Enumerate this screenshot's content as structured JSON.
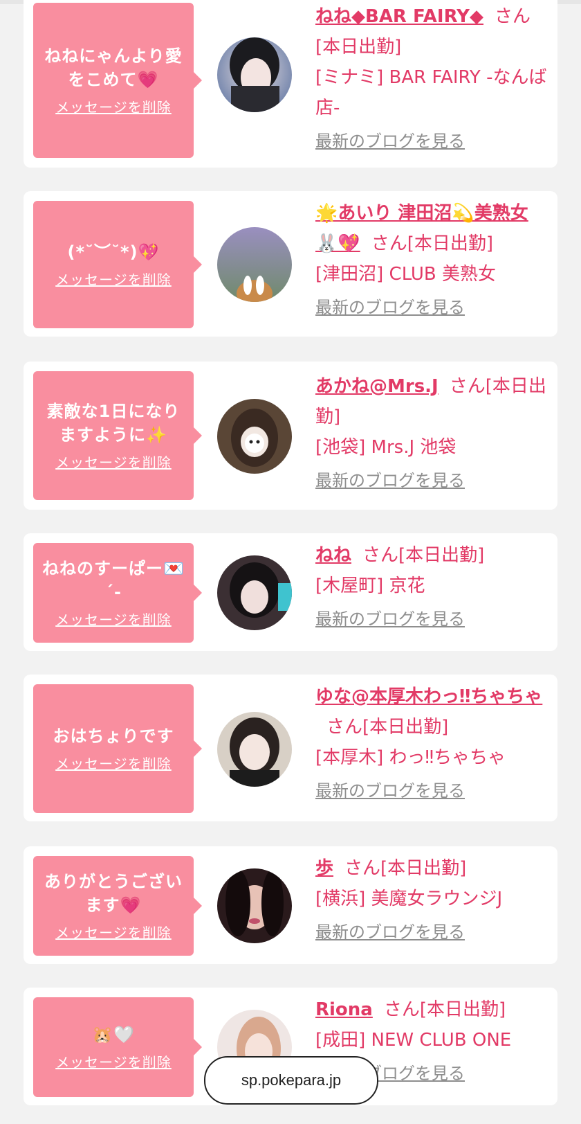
{
  "url_bar": {
    "text": "sp.pokepara.jp"
  },
  "cards": [
    {
      "message": "ねねにゃんより愛をこめて💗",
      "delete_label": "メッセージを削除",
      "name": "ねね◆BAR FAIRY◆",
      "san": "さん",
      "status": "[本日出勤]",
      "shop": "[ミナミ] BAR FAIRY -なんば店-",
      "blog": "最新のブログを見る"
    },
    {
      "message": "(*˘︶˘*)💖",
      "delete_label": "メッセージを削除",
      "name": "🌟あいり 津田沼💫美熟女🐰💖",
      "san": "さん",
      "status": "[本日出勤]",
      "shop": "[津田沼] CLUB 美熟女",
      "blog": "最新のブログを見る"
    },
    {
      "message": "素敵な1日になりますように✨",
      "delete_label": "メッセージを削除",
      "name": "あかね@Mrs.J",
      "san": "さん",
      "status": "[本日出勤]",
      "shop": "[池袋] Mrs.J 池袋",
      "blog": "最新のブログを見る"
    },
    {
      "message": "ねねのすーぱー💌´-",
      "delete_label": "メッセージを削除",
      "name": "ねね",
      "san": "さん",
      "status": "[本日出勤]",
      "shop": "[木屋町] 京花",
      "blog": "最新のブログを見る"
    },
    {
      "message": "おはちょりです",
      "delete_label": "メッセージを削除",
      "name": "ゆな@本厚木わっ‼ちゃちゃ",
      "san": "さん",
      "status": "[本日出勤]",
      "shop": "[本厚木] わっ‼ちゃちゃ",
      "blog": "最新のブログを見る"
    },
    {
      "message": "ありがとうございます💗",
      "delete_label": "メッセージを削除",
      "name": "歩",
      "san": "さん",
      "status": "[本日出勤]",
      "shop": "[横浜] 美魔女ラウンジJ",
      "blog": "最新のブログを見る"
    },
    {
      "message": "🐹🤍",
      "delete_label": "メッセージを削除",
      "name": "Riona",
      "san": "さん",
      "status": "[本日出勤]",
      "shop": "[成田] NEW CLUB ONE",
      "blog": "最新のブログを見る"
    }
  ]
}
